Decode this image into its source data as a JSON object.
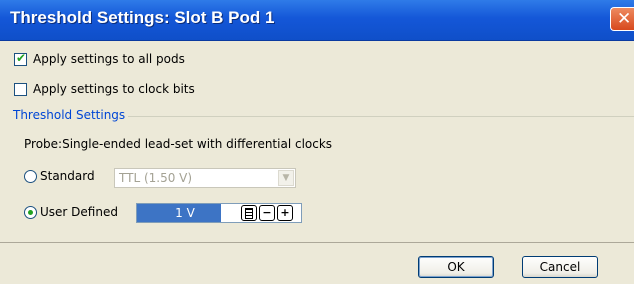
{
  "window": {
    "title": "Threshold Settings: Slot B Pod 1"
  },
  "options": {
    "apply_all_pods": {
      "label": "Apply settings to all pods",
      "checked": true
    },
    "apply_clock_bits": {
      "label": "Apply settings to clock bits",
      "checked": false
    }
  },
  "threshold": {
    "group_title": "Threshold Settings",
    "probe_text": "Probe:Single-ended lead-set with differential clocks",
    "standard": {
      "label": "Standard",
      "selected": false,
      "value": "TTL (1.50 V)"
    },
    "user_defined": {
      "label": "User Defined",
      "selected": true,
      "value": "1 V",
      "minus": "−",
      "plus": "+"
    }
  },
  "buttons": {
    "ok": "OK",
    "cancel": "Cancel"
  },
  "colors": {
    "titlebar": "#1457d8",
    "accent": "#0046d5",
    "check": "#21a121",
    "field_highlight": "#3d74c5"
  },
  "icons": [
    "close-icon",
    "check-icon",
    "calculator-icon",
    "chevron-down-icon",
    "minus-icon",
    "plus-icon"
  ]
}
